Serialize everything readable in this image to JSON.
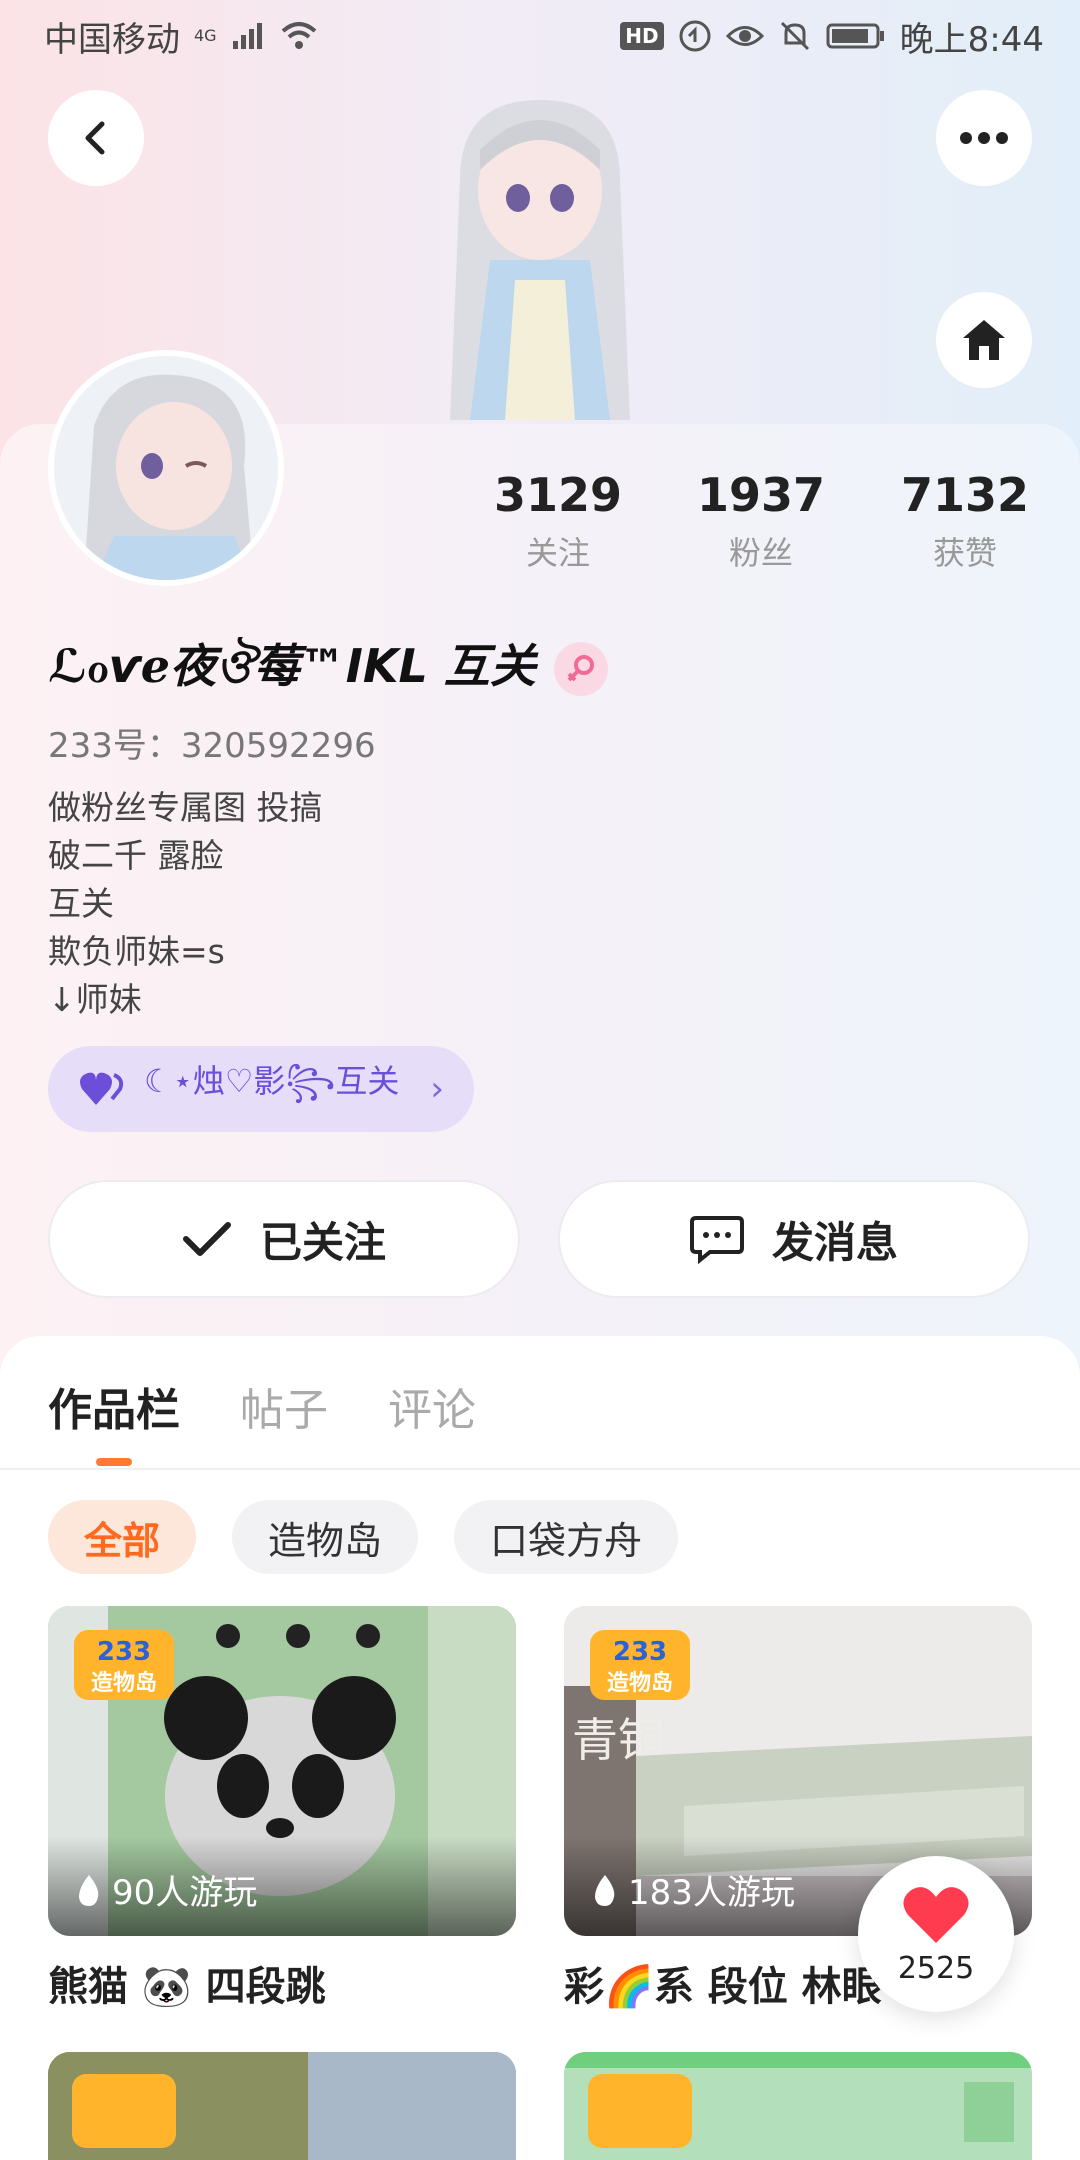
{
  "status_bar": {
    "carrier": "中国移动",
    "network": "4G",
    "time": "晚上8:44",
    "hd_badge": "HD"
  },
  "profile": {
    "name": "ℒℴѵℯ夜ঔ莓™IKL 互关",
    "uid": "233号：320592296",
    "bio": [
      "做粉丝专属图 投搞",
      "破二千 露脸",
      "互关",
      "欺负师妹=s",
      "↓师妹"
    ],
    "gender_icon": "female-icon"
  },
  "stats": [
    {
      "value": "3129",
      "label": "关注"
    },
    {
      "value": "1937",
      "label": "粉丝"
    },
    {
      "value": "7132",
      "label": "获赞"
    }
  ],
  "group_pill": {
    "label": "☾⋆烛♡影꧂互关"
  },
  "actions": {
    "follow_label": "已关注",
    "message_label": "发消息"
  },
  "tabs": [
    "作品栏",
    "帖子",
    "评论"
  ],
  "chips": [
    "全部",
    "造物岛",
    "口袋方舟"
  ],
  "works": [
    {
      "title": "熊猫 🐼 四段跳",
      "plays": "90人游玩"
    },
    {
      "title": "彩🌈系 段位 林眼",
      "plays": "183人游玩"
    }
  ],
  "badge": {
    "line1": "233",
    "line2": "造物岛"
  },
  "thumb_text": "青铜",
  "like": {
    "count": "2525"
  },
  "colors": {
    "accent": "#ff6a1f",
    "pill": "#e6def8",
    "heart": "#ff3b4f"
  }
}
